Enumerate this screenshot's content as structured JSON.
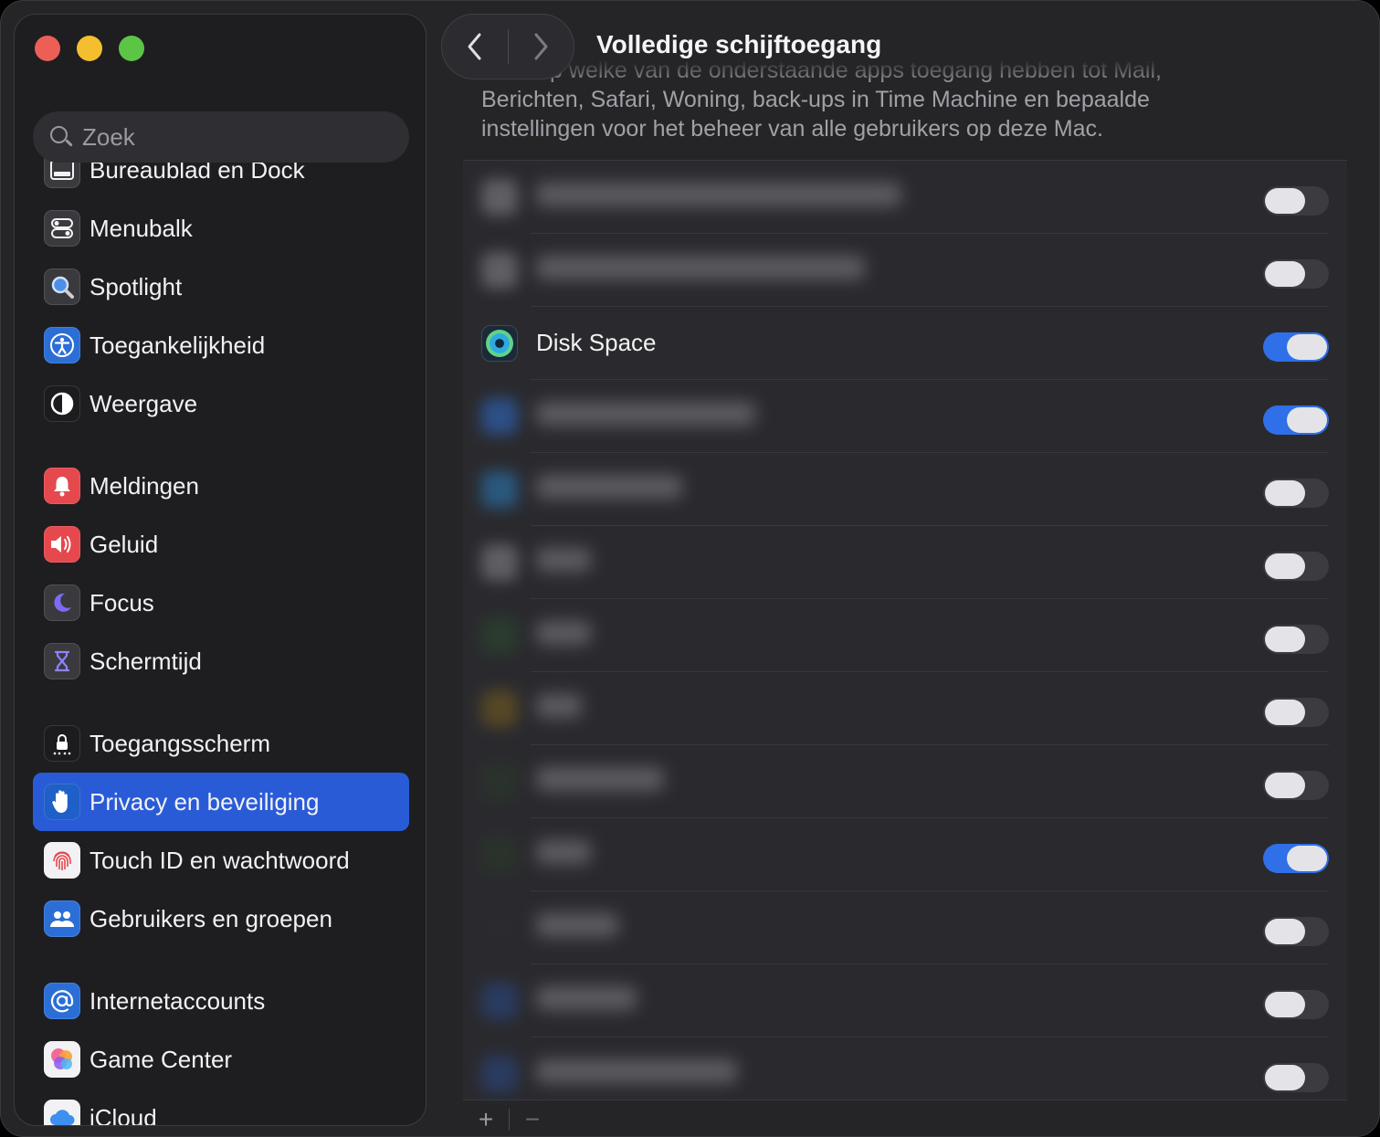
{
  "window": {
    "title": "Volledige schijftoegang"
  },
  "description": "Geef op welke van de onderstaande apps toegang hebben tot Mail, Berichten, Safari, Woning, back-ups in Time Machine en bepaalde instellingen voor het beheer van alle gebruikers op deze Mac.",
  "search": {
    "placeholder": "Zoek"
  },
  "sidebar": {
    "items": [
      {
        "label": "Bureaublad en Dock",
        "icon": "dock-icon",
        "color": "#3a3a3e"
      },
      {
        "label": "Menubalk",
        "icon": "menubar-icon",
        "color": "#3a3a3e"
      },
      {
        "label": "Spotlight",
        "icon": "spotlight-icon",
        "color": "#3a3a3e"
      },
      {
        "label": "Toegankelijkheid",
        "icon": "accessibility-icon",
        "color": "#2b6fd6"
      },
      {
        "label": "Weergave",
        "icon": "appearance-icon",
        "color": "#1c1c1e"
      },
      {
        "label": "Meldingen",
        "icon": "notifications-icon",
        "color": "#e5484d"
      },
      {
        "label": "Geluid",
        "icon": "sound-icon",
        "color": "#e5484d"
      },
      {
        "label": "Focus",
        "icon": "focus-icon",
        "color": "#5a4fd6"
      },
      {
        "label": "Schermtijd",
        "icon": "screen-time-icon",
        "color": "#5a4fd6"
      },
      {
        "label": "Toegangsscherm",
        "icon": "lock-screen-icon",
        "color": "#1c1c1e"
      },
      {
        "label": "Privacy en beveiliging",
        "icon": "privacy-hand-icon",
        "color": "#2b6fd6",
        "active": true
      },
      {
        "label": "Touch ID en wachtwoord",
        "icon": "fingerprint-icon",
        "color": "#f2f2f4"
      },
      {
        "label": "Gebruikers en groepen",
        "icon": "users-icon",
        "color": "#2b6fd6"
      },
      {
        "label": "Internetaccounts",
        "icon": "at-icon",
        "color": "#2b6fd6"
      },
      {
        "label": "Game Center",
        "icon": "game-center-icon",
        "color": "#f2f2f4"
      },
      {
        "label": "iCloud",
        "icon": "icloud-icon",
        "color": "#f2f2f4"
      }
    ]
  },
  "apps": [
    {
      "name": "",
      "enabled": false,
      "blurred": true
    },
    {
      "name": "",
      "enabled": false,
      "blurred": true
    },
    {
      "name": "Disk Space",
      "enabled": true,
      "blurred": false
    },
    {
      "name": "",
      "enabled": true,
      "blurred": true
    },
    {
      "name": "",
      "enabled": false,
      "blurred": true
    },
    {
      "name": "",
      "enabled": false,
      "blurred": true
    },
    {
      "name": "",
      "enabled": false,
      "blurred": true
    },
    {
      "name": "",
      "enabled": false,
      "blurred": true
    },
    {
      "name": "",
      "enabled": false,
      "blurred": true
    },
    {
      "name": "",
      "enabled": true,
      "blurred": true
    },
    {
      "name": "",
      "enabled": false,
      "blurred": true
    },
    {
      "name": "",
      "enabled": false,
      "blurred": true
    },
    {
      "name": "",
      "enabled": false,
      "blurred": true
    }
  ],
  "footer": {
    "add_label": "+",
    "remove_label": "−"
  },
  "colors": {
    "accent": "#2a5bd7",
    "toggle_on": "#2f6fe8"
  }
}
